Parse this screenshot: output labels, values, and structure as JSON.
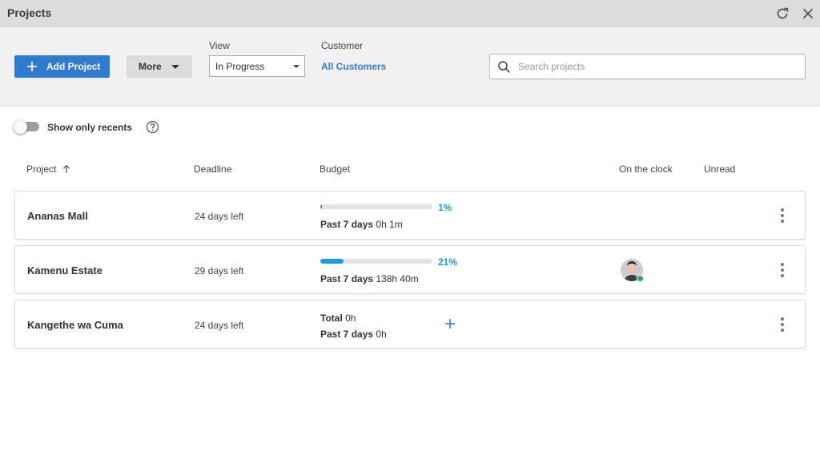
{
  "window": {
    "title": "Projects",
    "refresh_icon": "refresh-icon",
    "close_icon": "close-icon"
  },
  "toolbar": {
    "add_project_label": "Add Project",
    "more_label": "More",
    "view_label": "View",
    "view_value": "In Progress",
    "customer_label": "Customer",
    "customer_value": "All Customers",
    "search_placeholder": "Search projects",
    "search_value": ""
  },
  "filters": {
    "show_only_recents_label": "Show only recents",
    "show_only_recents_on": false
  },
  "columns": {
    "project": "Project",
    "deadline": "Deadline",
    "budget": "Budget",
    "on_the_clock": "On the clock",
    "unread": "Unread"
  },
  "projects": [
    {
      "name": "Ananas Mall",
      "deadline": "24 days left",
      "budget_percent_label": "1%",
      "budget_percent": 1,
      "past_label": "Past 7 days",
      "past_value": "0h 1m",
      "on_clock": false
    },
    {
      "name": "Kamenu Estate",
      "deadline": "29 days left",
      "budget_percent_label": "21%",
      "budget_percent": 21,
      "past_label": "Past 7 days",
      "past_value": "138h 40m",
      "on_clock": true
    },
    {
      "name": "Kangethe wa Cuma",
      "deadline": "24 days left",
      "total_label": "Total",
      "total_value": "0h",
      "past_label": "Past 7 days",
      "past_value": "0h",
      "on_clock": false
    }
  ],
  "colors": {
    "accent": "#2f7bd0",
    "progress": "#1e9be9",
    "online": "#27ae60"
  }
}
